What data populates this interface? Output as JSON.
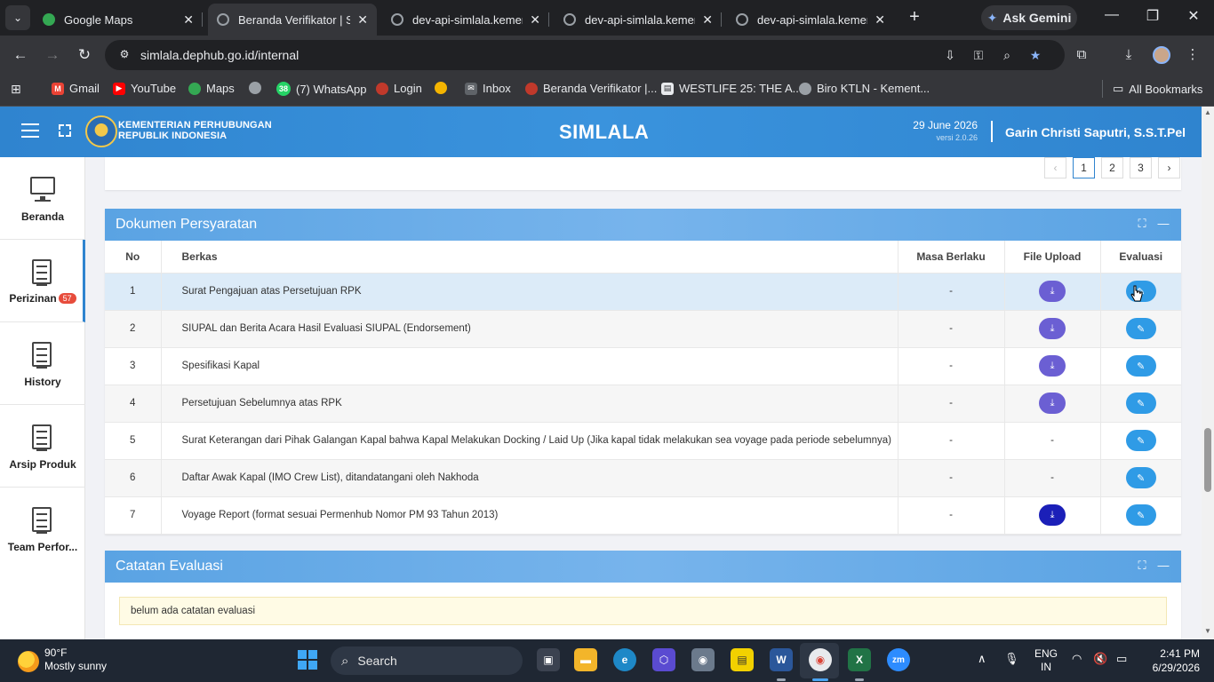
{
  "browser": {
    "tabs": [
      {
        "title": "Google Maps",
        "active": false
      },
      {
        "title": "Beranda Verifikator | Si",
        "active": true
      },
      {
        "title": "dev-api-simlala.kemenh",
        "active": false
      },
      {
        "title": "dev-api-simlala.kemenh",
        "active": false
      },
      {
        "title": "dev-api-simlala.kemenh",
        "active": false
      }
    ],
    "ask_gemini": "Ask Gemini",
    "url": "simlala.dephub.go.id/internal",
    "bookmarks": [
      {
        "label": "Gmail",
        "color": "#ea4335"
      },
      {
        "label": "YouTube",
        "color": "#ff0000"
      },
      {
        "label": "Maps",
        "color": "#34a853"
      },
      {
        "label": "",
        "color": "#9aa0a6"
      },
      {
        "label": "(7) WhatsApp",
        "color": "#25d366",
        "badge": "38"
      },
      {
        "label": "Login",
        "color": "#c0392b"
      },
      {
        "label": "",
        "color": "#f4b400"
      },
      {
        "label": "Inbox",
        "color": "#9aa0a6"
      },
      {
        "label": "Beranda Verifikator |...",
        "color": "#c0392b"
      },
      {
        "label": "WESTLIFE 25: THE A...",
        "color": "#e8eaed"
      },
      {
        "label": "Biro KTLN - Kement...",
        "color": "#9aa0a6"
      }
    ],
    "all_bookmarks": "All Bookmarks"
  },
  "header": {
    "ministry_line1": "KEMENTERIAN PERHUBUNGAN",
    "ministry_line2": "REPUBLIK INDONESIA",
    "app_title": "SIMLALA",
    "date": "29 June 2026",
    "version": "versi 2.0.26",
    "user": "Garin Christi Saputri, S.S.T.Pel"
  },
  "sidebar": {
    "items": [
      {
        "label": "Beranda",
        "icon": "monitor-icon"
      },
      {
        "label": "Perizinan",
        "icon": "document-icon",
        "badge": "57",
        "active": true
      },
      {
        "label": "History",
        "icon": "document-icon"
      },
      {
        "label": "Arsip Produk",
        "icon": "document-icon"
      },
      {
        "label": "Team Perfor...",
        "icon": "document-icon"
      }
    ]
  },
  "pagination": {
    "prev": "‹",
    "pages": [
      "1",
      "2",
      "3"
    ],
    "current": "1",
    "next": "›"
  },
  "documents": {
    "title": "Dokumen Persyaratan",
    "columns": {
      "no": "No",
      "berkas": "Berkas",
      "masa": "Masa Berlaku",
      "upload": "File Upload",
      "evaluasi": "Evaluasi"
    },
    "rows": [
      {
        "no": "1",
        "berkas": "Surat Pengajuan atas Persetujuan RPK",
        "masa": "-",
        "upload": "download",
        "highlight": true
      },
      {
        "no": "2",
        "berkas": "SIUPAL dan Berita Acara Hasil Evaluasi SIUPAL (Endorsement)",
        "masa": "-",
        "upload": "download"
      },
      {
        "no": "3",
        "berkas": "Spesifikasi Kapal",
        "masa": "-",
        "upload": "download"
      },
      {
        "no": "4",
        "berkas": "Persetujuan Sebelumnya atas RPK",
        "masa": "-",
        "upload": "download"
      },
      {
        "no": "5",
        "berkas": "Surat Keterangan dari Pihak Galangan Kapal bahwa Kapal Melakukan Docking / Laid Up (Jika kapal tidak melakukan sea voyage pada periode sebelumnya)",
        "masa": "-",
        "upload": "-"
      },
      {
        "no": "6",
        "berkas": "Daftar Awak Kapal (IMO Crew List), ditandatangani oleh Nakhoda",
        "masa": "-",
        "upload": "-"
      },
      {
        "no": "7",
        "berkas": "Voyage Report (format sesuai Permenhub Nomor PM 93 Tahun 2013)",
        "masa": "-",
        "upload": "download-dark"
      }
    ]
  },
  "evaluation": {
    "title": "Catatan Evaluasi",
    "note": "belum ada catatan evaluasi"
  },
  "taskbar": {
    "temp": "90°F",
    "weather": "Mostly sunny",
    "search_placeholder": "Search",
    "lang1": "ENG",
    "lang2": "IN",
    "time": "2:41 PM",
    "date": "6/29/2026"
  },
  "colors": {
    "header": "#2f84cf",
    "card_head": "#5aa3e3",
    "download_btn": "#6b5fd3",
    "eval_btn": "#2f9be6"
  }
}
